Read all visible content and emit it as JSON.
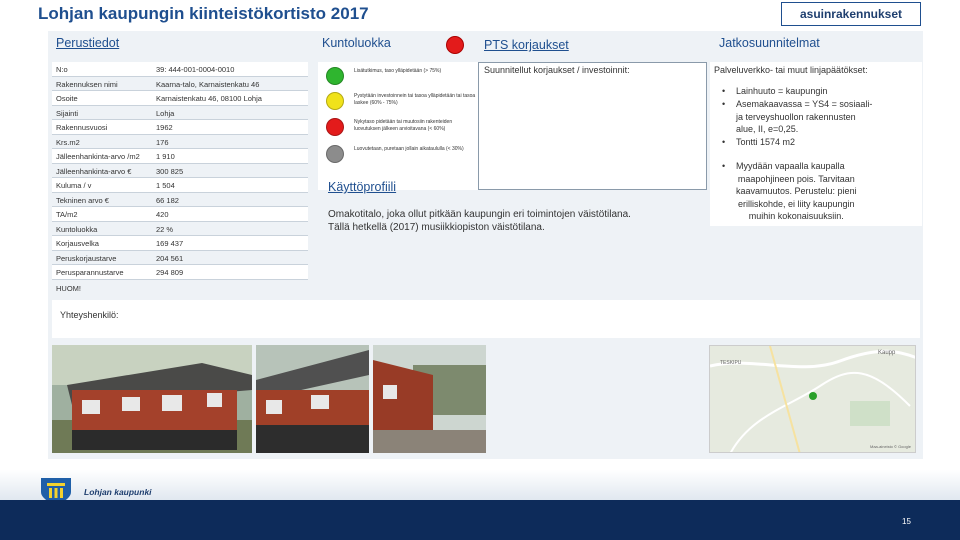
{
  "header": {
    "title": "Lohjan kaupungin kiinteistökortisto 2017",
    "badge": "asuinrakennukset"
  },
  "sections": {
    "basic": "Perustiedot",
    "condition": "Kuntoluokka",
    "pts": "PTS korjaukset",
    "followup": "Jatkosuunnitelmat",
    "profile": "Käyttöprofiili"
  },
  "colors": {
    "green": "#2fb52f",
    "yellow": "#f0e21a",
    "red": "#e31b1b",
    "gray": "#8c8c8c"
  },
  "basic_rows": [
    {
      "key": "N:o",
      "value": "39: 444-001-0004-0010"
    },
    {
      "key": "Rakennuksen nimi",
      "value": "Kaarna-talo, Karnaistenkatu 46"
    },
    {
      "key": "Osoite",
      "value": "Karnaistenkatu 46, 08100 Lohja"
    },
    {
      "key": "Sijainti",
      "value": "Lohja"
    },
    {
      "key": "Rakennusvuosi",
      "value": "1962"
    },
    {
      "key": "Krs.m2",
      "value": "176"
    },
    {
      "key": "Jälleenhankinta-arvo /m2",
      "value": "1 910"
    },
    {
      "key": "Jälleenhankinta-arvo €",
      "value": "300 825"
    },
    {
      "key": "Kulumа / v",
      "value": "1 504"
    },
    {
      "key": "Tekninen arvo €",
      "value": "66 182"
    },
    {
      "key": "TA/m2",
      "value": "420"
    },
    {
      "key": "Kuntoluokka",
      "value": "22 %"
    },
    {
      "key": "Korjausvelka",
      "value": "169 437"
    },
    {
      "key": "Peruskorjaustarve",
      "value": "204 561"
    },
    {
      "key": "Perusparannustarve",
      "value": "294 809"
    }
  ],
  "condition_legend": [
    {
      "color": "green",
      "text": "Lisätutkimus, taso ylläpidetään (> 75%)"
    },
    {
      "color": "yellow",
      "text": "Pystytään investoinnein tai tasoa ylläpidetään tai tasoa laskee (60% - 75%)"
    },
    {
      "color": "red",
      "text": "Nykytaso pidetään tai muutosiin rakenteiden luovutuksen jälkeen arvioitavana (< 60%)"
    },
    {
      "color": "gray",
      "text": "Luovutetaan, puretaan jollain aikataululla (< 30%)"
    }
  ],
  "pts_text": "Suunnitellut korjaukset / investoinnit:",
  "followup": {
    "intro": "Palveluverkko- tai muut linjapäätökset:",
    "bullets": [
      [
        "Lainhuuto = kaupungin"
      ],
      [
        "Asemakaavassa = YS4 = sosiaali-",
        "ja terveyshuollon rakennusten",
        "alue, II, e=0,25."
      ],
      [
        "Tontti 1574 m2"
      ],
      [
        "Myydään vapaalla kaupalla",
        "maapohjineen pois. Tarvitaan",
        "kaavamuutos. Perustelu: pieni",
        "erilliskohde, ei liity kaupungin",
        "muihin kokonaisuuksiin."
      ]
    ]
  },
  "profile_text": [
    "Omakotitalo, joka ollut pitkään kaupungin eri toimintojen väistötilana.",
    "Tällä hetkellä (2017) musiikkiopiston väistötilana."
  ],
  "huom": "HUOM!",
  "contact": "Yhteyshenkilö:",
  "map": {
    "label1": "Kaupp",
    "label2": "TESKIPU",
    "credit": "Maa-aineisto © Google"
  },
  "footer": {
    "logo_text": "Lohjan kaupunki",
    "page": "15"
  }
}
